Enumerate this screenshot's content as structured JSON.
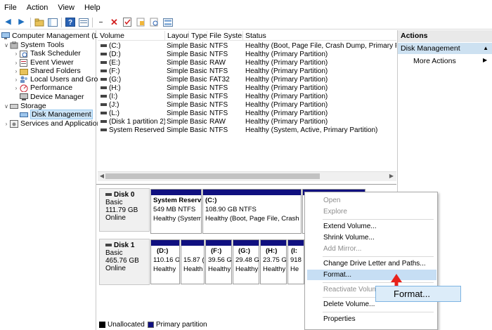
{
  "menubar": {
    "items": [
      "File",
      "Action",
      "View",
      "Help"
    ]
  },
  "tree": {
    "root": "Computer Management (Local",
    "system_tools": "System Tools",
    "children": [
      "Task Scheduler",
      "Event Viewer",
      "Shared Folders",
      "Local Users and Groups",
      "Performance",
      "Device Manager"
    ],
    "storage": "Storage",
    "disk_management": "Disk Management",
    "services": "Services and Applications"
  },
  "volume_list": {
    "headers": [
      "Volume",
      "Layout",
      "Type",
      "File System",
      "Status"
    ],
    "rows": [
      {
        "volume": "(C:)",
        "layout": "Simple",
        "type": "Basic",
        "fs": "NTFS",
        "status": "Healthy (Boot, Page File, Crash Dump, Primary Partition)"
      },
      {
        "volume": "(D:)",
        "layout": "Simple",
        "type": "Basic",
        "fs": "NTFS",
        "status": "Healthy (Primary Partition)"
      },
      {
        "volume": "(E:)",
        "layout": "Simple",
        "type": "Basic",
        "fs": "RAW",
        "status": "Healthy (Primary Partition)"
      },
      {
        "volume": "(F:)",
        "layout": "Simple",
        "type": "Basic",
        "fs": "NTFS",
        "status": "Healthy (Primary Partition)"
      },
      {
        "volume": "(G:)",
        "layout": "Simple",
        "type": "Basic",
        "fs": "FAT32",
        "status": "Healthy (Primary Partition)"
      },
      {
        "volume": "(H:)",
        "layout": "Simple",
        "type": "Basic",
        "fs": "NTFS",
        "status": "Healthy (Primary Partition)"
      },
      {
        "volume": "(I:)",
        "layout": "Simple",
        "type": "Basic",
        "fs": "NTFS",
        "status": "Healthy (Primary Partition)"
      },
      {
        "volume": "(J:)",
        "layout": "Simple",
        "type": "Basic",
        "fs": "NTFS",
        "status": "Healthy (Primary Partition)"
      },
      {
        "volume": "(L:)",
        "layout": "Simple",
        "type": "Basic",
        "fs": "NTFS",
        "status": "Healthy (Primary Partition)"
      },
      {
        "volume": "(Disk 1 partition 2)",
        "layout": "Simple",
        "type": "Basic",
        "fs": "RAW",
        "status": "Healthy (Primary Partition)"
      },
      {
        "volume": "System Reserved (K:)",
        "layout": "Simple",
        "type": "Basic",
        "fs": "NTFS",
        "status": "Healthy (System, Active, Primary Partition)"
      }
    ]
  },
  "disks": [
    {
      "name": "Disk 0",
      "type": "Basic",
      "size": "111.79 GB",
      "state": "Online",
      "partitions": [
        {
          "name": "System Reserve",
          "size": "549 MB NTFS",
          "status": "Healthy (System,"
        },
        {
          "name": "(C:)",
          "size": "108.90 GB NTFS",
          "status": "Healthy (Boot, Page File, Crash Du"
        }
      ]
    },
    {
      "name": "Disk 1",
      "type": "Basic",
      "size": "465.76 GB",
      "state": "Online",
      "partitions": [
        {
          "name": "(D:)",
          "size": "110.16 G",
          "status": "Healthy"
        },
        {
          "name": "",
          "size": "15.87 (",
          "status": "Health"
        },
        {
          "name": "(F:)",
          "size": "39.56 G",
          "status": "Healthy"
        },
        {
          "name": "(G:)",
          "size": "29.48 G",
          "status": "Healthy"
        },
        {
          "name": "(H:)",
          "size": "23.75 G",
          "status": "Healthy"
        },
        {
          "name": "(I:",
          "size": "918",
          "status": "He"
        }
      ]
    }
  ],
  "legend": [
    "Unallocated",
    "Primary partition"
  ],
  "actions": {
    "title": "Actions",
    "section": "Disk Management",
    "more": "More Actions"
  },
  "context_menu": {
    "items": [
      "Open",
      "Explore",
      "Extend Volume...",
      "Shrink Volume...",
      "Add Mirror...",
      "Change Drive Letter and Paths...",
      "Format...",
      "Reactivate Volume",
      "Delete Volume...",
      "Properties"
    ],
    "disabled": [
      "Open",
      "Explore",
      "Add Mirror...",
      "Reactivate Volume"
    ],
    "highlighted": "Format..."
  },
  "callout": {
    "label": "Format..."
  },
  "colors": {
    "primary_partition": "#101080",
    "highlight": "#c6def4",
    "selection": "#cce4f7",
    "arrow": "#e8221b"
  }
}
